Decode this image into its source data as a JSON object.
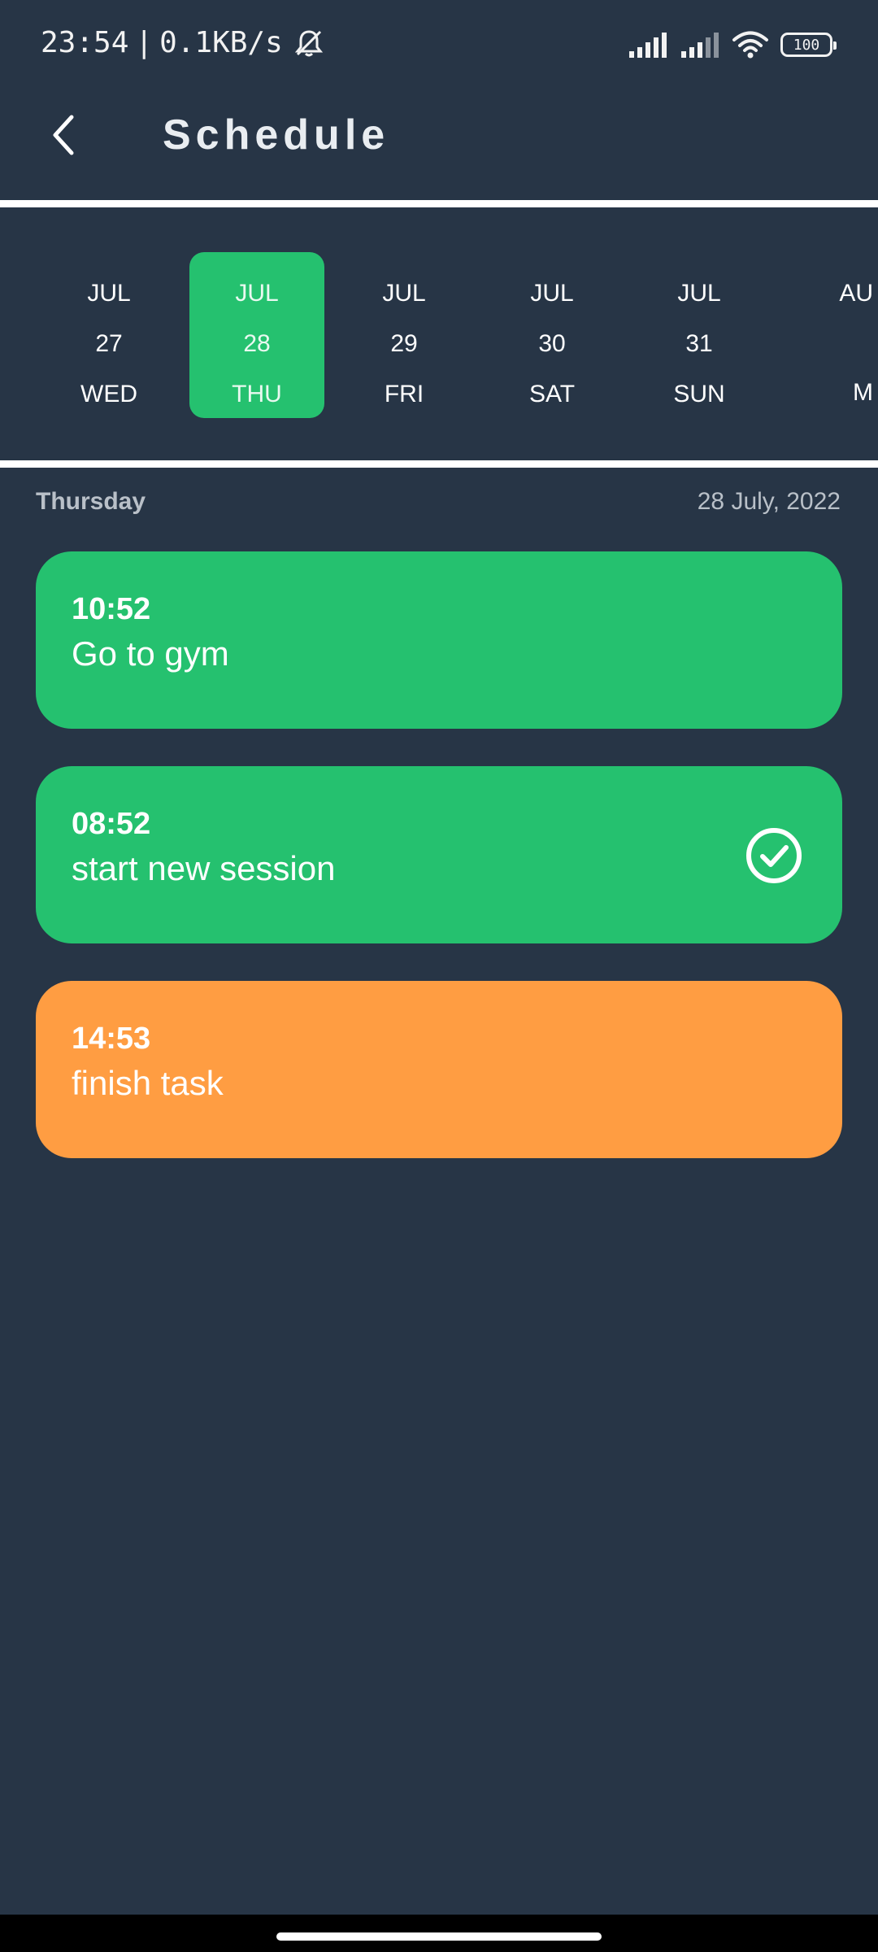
{
  "status_bar": {
    "time": "23:54",
    "separator": "|",
    "network_speed": "0.1KB/s",
    "battery": "100",
    "icons": [
      "mute-bell-icon",
      "signal-icon",
      "signal-icon",
      "wifi-icon",
      "battery-icon"
    ]
  },
  "app_bar": {
    "back_icon": "chevron-left-icon",
    "title": "Schedule"
  },
  "date_strip": {
    "selected_index": 1,
    "selected_color": "#25c16f",
    "dates": [
      {
        "month": "JUL",
        "day": "27",
        "weekday": "WED"
      },
      {
        "month": "JUL",
        "day": "28",
        "weekday": "THU"
      },
      {
        "month": "JUL",
        "day": "29",
        "weekday": "FRI"
      },
      {
        "month": "JUL",
        "day": "30",
        "weekday": "SAT"
      },
      {
        "month": "JUL",
        "day": "31",
        "weekday": "SUN"
      },
      {
        "month": "AU",
        "day": "",
        "weekday": "M"
      }
    ]
  },
  "day_header": {
    "day_name": "Thursday",
    "full_date": "28 July, 2022"
  },
  "tasks": [
    {
      "time": "10:52",
      "title": "Go to gym",
      "color": "#25c16f",
      "completed": false
    },
    {
      "time": "08:52",
      "title": "start new session",
      "color": "#25c16f",
      "completed": true
    },
    {
      "time": "14:53",
      "title": "finish task",
      "color": "#ff9d42",
      "completed": false
    }
  ],
  "colors": {
    "background": "#273546",
    "accent_green": "#25c16f",
    "accent_orange": "#ff9d42"
  }
}
